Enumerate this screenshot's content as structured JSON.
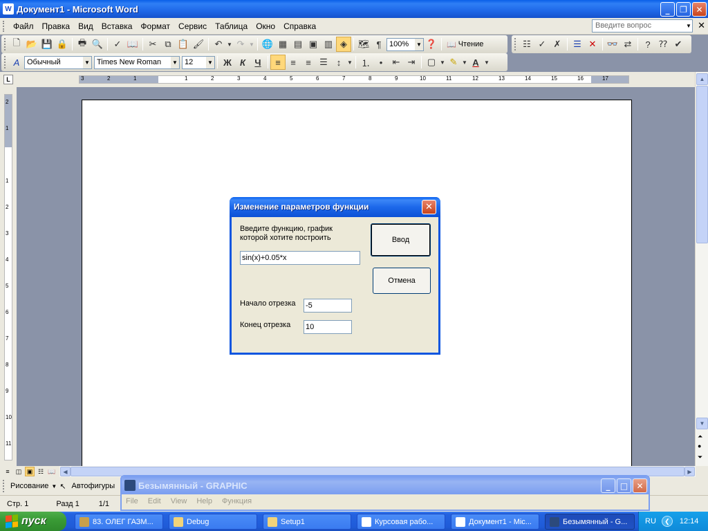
{
  "window": {
    "title": "Документ1 - Microsoft Word",
    "icon": "word-icon"
  },
  "menubar": {
    "items": [
      "Файл",
      "Правка",
      "Вид",
      "Вставка",
      "Формат",
      "Сервис",
      "Таблица",
      "Окно",
      "Справка"
    ],
    "ask_placeholder": "Введите вопрос"
  },
  "toolbar": {
    "zoom": "100%",
    "reading_label": "Чтение",
    "style": "Обычный",
    "font": "Times New Roman",
    "size": "12",
    "bold": "Ж",
    "italic": "К",
    "underline": "Ч"
  },
  "ruler": {
    "top_numbers": [
      "3",
      "2",
      "1",
      "1",
      "2",
      "3",
      "4",
      "5",
      "6",
      "7",
      "8",
      "9",
      "10",
      "11",
      "12",
      "13",
      "14",
      "15",
      "16",
      "17"
    ],
    "left_numbers": [
      "2",
      "1",
      "1",
      "2",
      "3",
      "4",
      "5",
      "6",
      "7",
      "8",
      "9",
      "10",
      "11"
    ],
    "corner": "L"
  },
  "dialog": {
    "title": "Изменение  параметров функции",
    "prompt_line1": "Введите функцию, график",
    "prompt_line2": "которой хотите построить",
    "function_value": "sin(x)+0.05*x",
    "start_label": "Начало отрезка",
    "start_value": "-5",
    "end_label": "Конец отрезка",
    "end_value": "10",
    "ok_label": "Ввод",
    "cancel_label": "Отмена"
  },
  "graphic_window": {
    "title": "Безымянный - GRAPHIC",
    "menu": [
      "File",
      "Edit",
      "View",
      "Help",
      "Функция"
    ]
  },
  "drawbar": {
    "draw_label": "Рисование",
    "autoshapes_label": "Автофигуры"
  },
  "statusbar": {
    "page": "Стр. 1",
    "section": "Разд 1",
    "pages": "1/1"
  },
  "taskbar": {
    "start_label": "пуск",
    "tasks": [
      {
        "label": "83. ОЛЕГ ГАЗМ...",
        "icon": "winrar-icon"
      },
      {
        "label": "Debug",
        "icon": "folder-icon"
      },
      {
        "label": "Setup1",
        "icon": "folder-icon"
      },
      {
        "label": "Курсовая рабо...",
        "icon": "word-icon"
      },
      {
        "label": "Документ1 - Mic...",
        "icon": "word-icon"
      },
      {
        "label": "Безымянный - G...",
        "icon": "graphic-app-icon"
      }
    ],
    "lang": "RU",
    "clock": "12:14"
  },
  "colors": {
    "xp_blue": "#0b55e0",
    "dialog_bg": "#ece9d8",
    "start_green": "#3a9b36"
  }
}
